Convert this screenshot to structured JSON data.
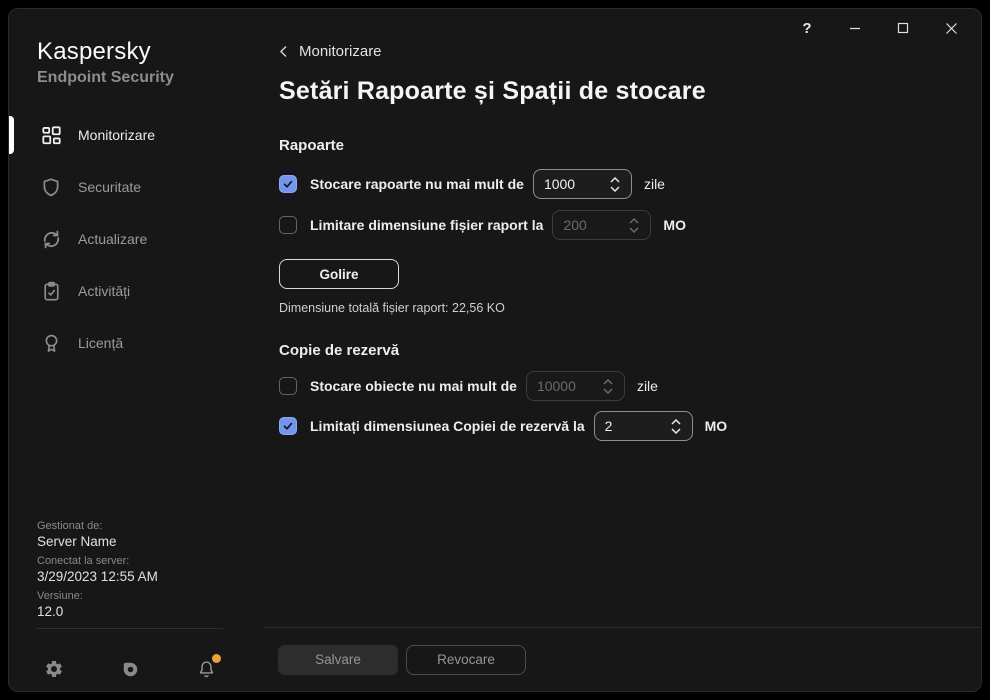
{
  "titlebar": {
    "help_label": "?"
  },
  "sidebar": {
    "brand": {
      "name": "Kaspersky",
      "product": "Endpoint Security"
    },
    "items": [
      {
        "label": "Monitorizare",
        "icon": "dashboard-icon",
        "active": true
      },
      {
        "label": "Securitate",
        "icon": "shield-icon",
        "active": false
      },
      {
        "label": "Actualizare",
        "icon": "refresh-icon",
        "active": false
      },
      {
        "label": "Activități",
        "icon": "tasks-icon",
        "active": false
      },
      {
        "label": "Licență",
        "icon": "license-icon",
        "active": false
      }
    ],
    "info": [
      {
        "label": "Gestionat de:",
        "value": "Server Name"
      },
      {
        "label": "Conectat la server:",
        "value": "3/29/2023 12:55 AM"
      },
      {
        "label": "Versiune:",
        "value": "12.0"
      }
    ]
  },
  "content": {
    "breadcrumb": "Monitorizare",
    "title": "Setări Rapoarte și Spații de stocare",
    "sections": {
      "reports": {
        "heading": "Rapoarte",
        "rows": [
          {
            "label": "Stocare rapoarte nu mai mult de",
            "value": "1000",
            "suffix": "zile",
            "checked": true,
            "enabled": true
          },
          {
            "label": "Limitare dimensiune fișier raport la",
            "value": "200",
            "suffix": "MO",
            "checked": false,
            "enabled": false
          }
        ],
        "clear_button": "Golire",
        "total": "Dimensiune totală fișier raport: 22,56 KO"
      },
      "backup": {
        "heading": "Copie de rezervă",
        "rows": [
          {
            "label": "Stocare obiecte nu mai mult de",
            "value": "10000",
            "suffix": "zile",
            "checked": false,
            "enabled": false
          },
          {
            "label": "Limitați dimensiunea Copiei de rezervă la",
            "value": "2",
            "suffix": "MO",
            "checked": true,
            "enabled": true
          }
        ]
      }
    },
    "actions": {
      "save": "Salvare",
      "cancel": "Revocare"
    }
  },
  "colors": {
    "accent_blue": "#7495EE",
    "notification_dot": "#EAA23B",
    "window_bg": "#171717"
  }
}
